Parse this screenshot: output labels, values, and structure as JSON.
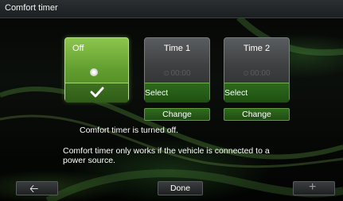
{
  "window": {
    "title": "Comfort timer"
  },
  "modes": {
    "off": {
      "label": "Off",
      "icon": "power-icon",
      "selected_icon": "checkmark-icon"
    },
    "time1": {
      "label": "Time 1",
      "time": "00:00",
      "action_label": "Select",
      "change_label": "Change"
    },
    "time2": {
      "label": "Time 2",
      "time": "00:00",
      "action_label": "Select",
      "change_label": "Change"
    }
  },
  "status_text": "Comfort timer is turned off.",
  "info_text": "Comfort timer only works if the vehicle is connected to a power source.",
  "bottom_bar": {
    "back_icon": "back-arrow-icon",
    "done_label": "Done",
    "add_icon": "plus-icon"
  },
  "colors": {
    "accent_green": "#5e9a2c",
    "button_green": "#2d6a1c",
    "titlebar": "#2b2f31"
  }
}
